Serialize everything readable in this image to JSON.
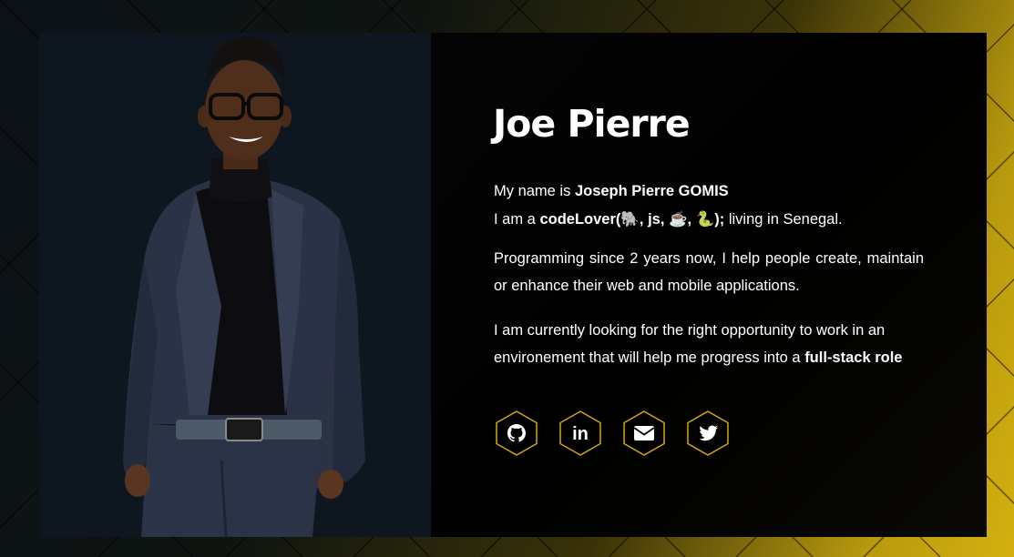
{
  "profile": {
    "name": "Joe Pierre",
    "intro_line1_prefix": "My name is ",
    "full_name": "Joseph Pierre GOMIS",
    "intro_line2_prefix": "I am a ",
    "code_lover": "codeLover(🐘, js, ☕, 🐍);",
    "intro_line2_suffix": " living in Senegal.",
    "para1": "Programming since 2 years now, I help people create, maintain or enhance their web and mobile applications.",
    "para2_prefix": "I am currently looking for the right opportunity to work in an environement that will help me progress into a ",
    "para2_bold": "full-stack role"
  },
  "socials": [
    {
      "name": "github",
      "icon": "github-icon"
    },
    {
      "name": "linkedin",
      "icon": "linkedin-icon",
      "label": "in"
    },
    {
      "name": "email",
      "icon": "envelope-icon"
    },
    {
      "name": "twitter",
      "icon": "twitter-icon"
    }
  ],
  "colors": {
    "accent": "#d4a90f",
    "panel_left": "#0e1720",
    "panel_right": "#000000",
    "text": "#ffffff"
  }
}
